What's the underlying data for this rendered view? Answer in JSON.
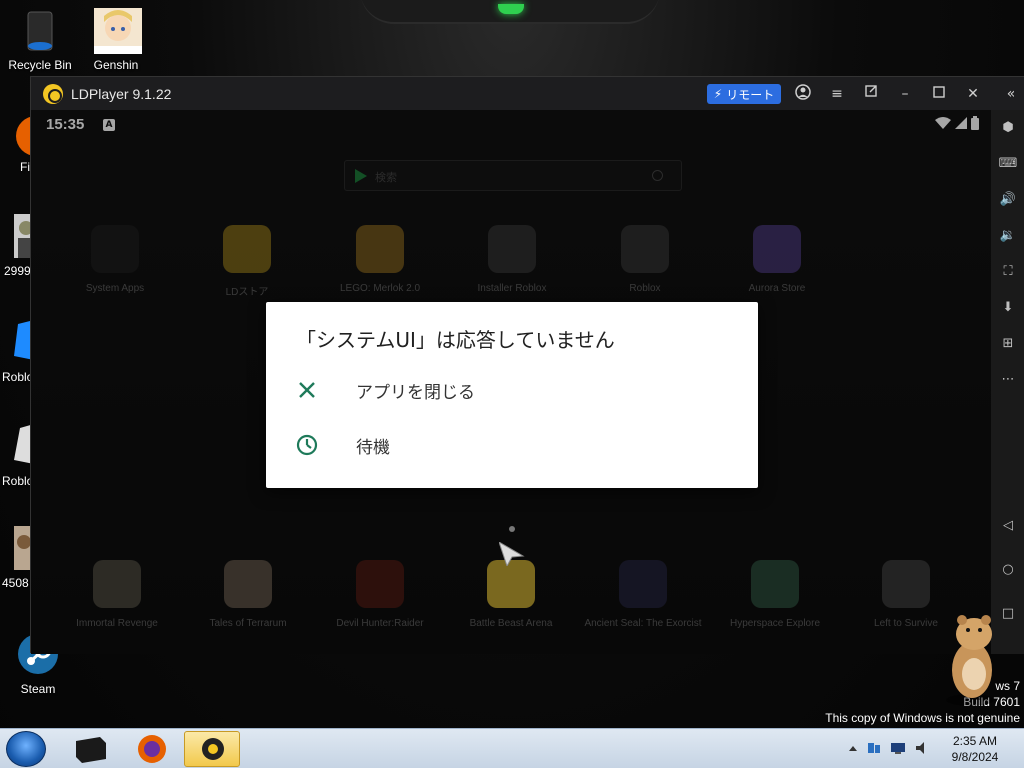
{
  "desktop": {
    "icons": [
      {
        "label": "Recycle Bin"
      },
      {
        "label": "Genshin"
      },
      {
        "label": "Fi"
      },
      {
        "label": "2999"
      },
      {
        "label": "Roblo"
      },
      {
        "label": "Roblo"
      },
      {
        "label": "4508"
      },
      {
        "label": "Steam"
      }
    ]
  },
  "window": {
    "title": "LDPlayer 9.1.22",
    "remote_label": "リモート"
  },
  "android": {
    "time": "15:35",
    "search_placeholder": "検索",
    "apps_top": [
      {
        "label": "System Apps"
      },
      {
        "label": "LDストア"
      },
      {
        "label": "LEGO: Merlok 2.0"
      },
      {
        "label": "Installer Roblox"
      },
      {
        "label": "Roblox"
      },
      {
        "label": "Aurora Store"
      }
    ],
    "apps_bottom": [
      {
        "label": "Immortal Revenge"
      },
      {
        "label": "Tales of Terrarum"
      },
      {
        "label": "Devil Hunter:Raider"
      },
      {
        "label": "Battle Beast Arena"
      },
      {
        "label": "Ancient Seal: The Exorcist"
      },
      {
        "label": "Hyperspace Explore"
      },
      {
        "label": "Left to Survive"
      }
    ]
  },
  "dialog": {
    "title": "「システムUI」は応答していません",
    "close_app_label": "アプリを閉じる",
    "wait_label": "待機"
  },
  "taskbar": {
    "time": "2:35 AM",
    "date": "9/8/2024"
  },
  "watermark": {
    "line1": "ws 7",
    "line2": "Build 7601",
    "line3": "This copy of Windows is not genuine"
  },
  "colors": {
    "accent_green": "#1e7a5a",
    "remote_blue": "#2c6de0",
    "ld_yellow": "#f3c623"
  }
}
